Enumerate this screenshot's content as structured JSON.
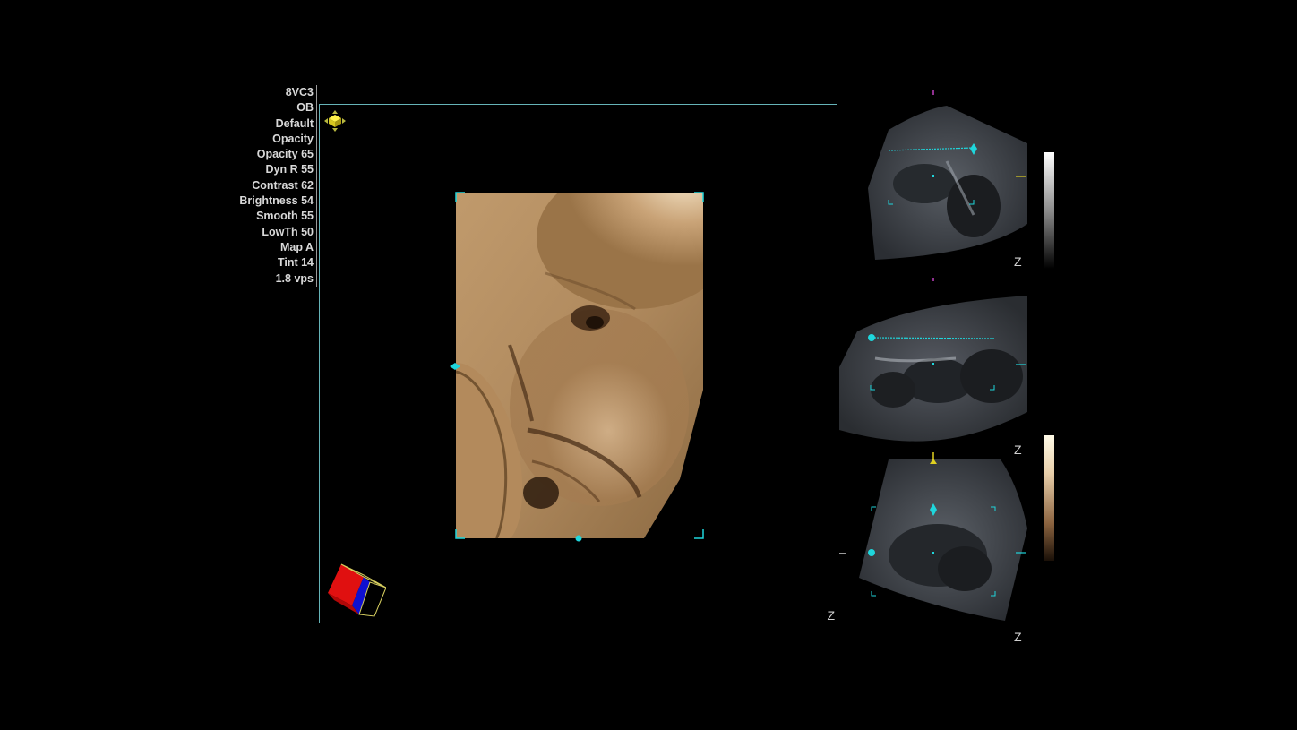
{
  "parameters": [
    {
      "id": "probe",
      "label": "8VC3"
    },
    {
      "id": "application",
      "label": "OB"
    },
    {
      "id": "preset",
      "label": "Default"
    },
    {
      "id": "render-mode",
      "label": "Opacity"
    },
    {
      "id": "opacity",
      "label": "Opacity 65"
    },
    {
      "id": "dyn-range",
      "label": "Dyn R 55"
    },
    {
      "id": "contrast",
      "label": "Contrast 62"
    },
    {
      "id": "brightness",
      "label": "Brightness 54"
    },
    {
      "id": "smooth",
      "label": "Smooth 55"
    },
    {
      "id": "low-threshold",
      "label": "LowTh 50"
    },
    {
      "id": "map",
      "label": "Map A"
    },
    {
      "id": "tint",
      "label": "Tint 14"
    },
    {
      "id": "volume-rate",
      "label": "1.8 vps"
    }
  ],
  "main_view": {
    "z_label": "Z"
  },
  "side_panes": {
    "pane_a": {
      "z_label": "Z"
    },
    "pane_b": {
      "z_label": "Z"
    },
    "pane_c": {
      "z_label": "Z"
    }
  },
  "colors": {
    "frame": "#66b3b8",
    "marker": "#1fd6dc",
    "sepia_light": "#e8cfaa",
    "sepia_dark": "#6b4a28",
    "ref_arrow_magenta": "#c040c0",
    "ref_arrow_yellow": "#e0d020"
  },
  "icons": {
    "move_handle": "move-arrows-icon",
    "orientation_cube": "orientation-cube-icon"
  }
}
